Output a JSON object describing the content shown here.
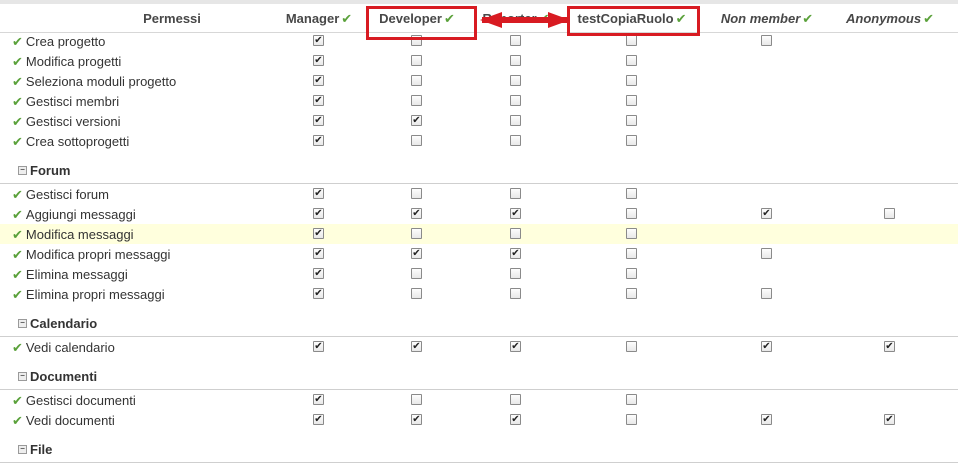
{
  "header": {
    "permissions": "Permessi",
    "roles": [
      {
        "name": "Manager",
        "italic": false
      },
      {
        "name": "Developer",
        "italic": false
      },
      {
        "name": "Reporter",
        "italic": false
      },
      {
        "name": "testCopiaRuolo",
        "italic": false
      },
      {
        "name": "Non member",
        "italic": true
      },
      {
        "name": "Anonymous",
        "italic": true
      }
    ]
  },
  "rows": [
    {
      "label": "Crea progetto",
      "cb": [
        true,
        false,
        false,
        false,
        false,
        null
      ]
    },
    {
      "label": "Modifica progetti",
      "cb": [
        true,
        false,
        false,
        false,
        null,
        null
      ]
    },
    {
      "label": "Seleziona moduli progetto",
      "cb": [
        true,
        false,
        false,
        false,
        null,
        null
      ]
    },
    {
      "label": "Gestisci membri",
      "cb": [
        true,
        false,
        false,
        false,
        null,
        null
      ]
    },
    {
      "label": "Gestisci versioni",
      "cb": [
        true,
        true,
        false,
        false,
        null,
        null
      ]
    },
    {
      "label": "Crea sottoprogetti",
      "cb": [
        true,
        false,
        false,
        false,
        null,
        null
      ]
    }
  ],
  "groups": [
    {
      "title": "Forum",
      "rows": [
        {
          "label": "Gestisci forum",
          "cb": [
            true,
            false,
            false,
            false,
            null,
            null
          ]
        },
        {
          "label": "Aggiungi messaggi",
          "cb": [
            true,
            true,
            true,
            false,
            true,
            false
          ]
        },
        {
          "label": "Modifica messaggi",
          "cb": [
            true,
            false,
            false,
            false,
            null,
            null
          ],
          "highlight": true
        },
        {
          "label": "Modifica propri messaggi",
          "cb": [
            true,
            true,
            true,
            false,
            false,
            null
          ]
        },
        {
          "label": "Elimina messaggi",
          "cb": [
            true,
            false,
            false,
            false,
            null,
            null
          ]
        },
        {
          "label": "Elimina propri messaggi",
          "cb": [
            true,
            false,
            false,
            false,
            false,
            null
          ]
        }
      ]
    },
    {
      "title": "Calendario",
      "rows": [
        {
          "label": "Vedi calendario",
          "cb": [
            true,
            true,
            true,
            false,
            true,
            true
          ]
        }
      ]
    },
    {
      "title": "Documenti",
      "rows": [
        {
          "label": "Gestisci documenti",
          "cb": [
            true,
            false,
            false,
            false,
            null,
            null
          ]
        },
        {
          "label": "Vedi documenti",
          "cb": [
            true,
            true,
            true,
            false,
            true,
            true
          ]
        }
      ]
    },
    {
      "title": "File",
      "rows": []
    }
  ],
  "icons": {
    "check": "check-icon",
    "collapse": "collapse-icon"
  },
  "colors": {
    "check": "#5aa13a",
    "highlight_row": "#ffffdd",
    "annotation_red": "#d81b22"
  }
}
